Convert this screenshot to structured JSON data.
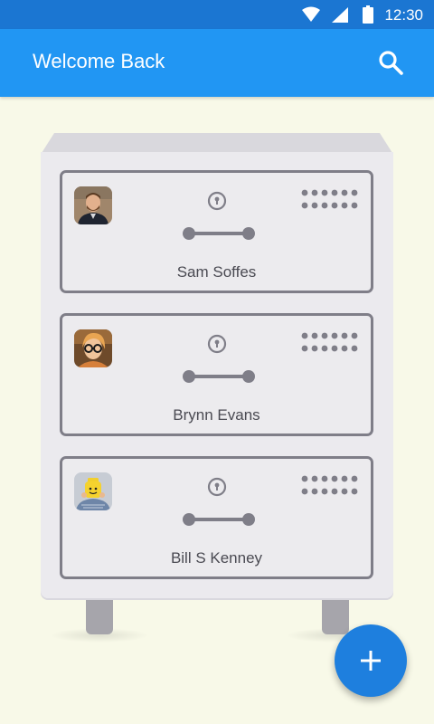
{
  "status_bar": {
    "time": "12:30",
    "icons": [
      "wifi-icon",
      "signal-icon",
      "battery-icon"
    ]
  },
  "app_bar": {
    "title": "Welcome Back",
    "search_icon": "search-icon"
  },
  "profiles": [
    {
      "name": "Sam Soffes"
    },
    {
      "name": "Brynn Evans"
    },
    {
      "name": "Bill S Kenney"
    }
  ],
  "fab": {
    "icon": "plus-icon"
  },
  "colors": {
    "app_bar": "#2196f3",
    "status_bar": "#1b76d2",
    "fab": "#1e7fde",
    "background": "#f8f9e8"
  }
}
